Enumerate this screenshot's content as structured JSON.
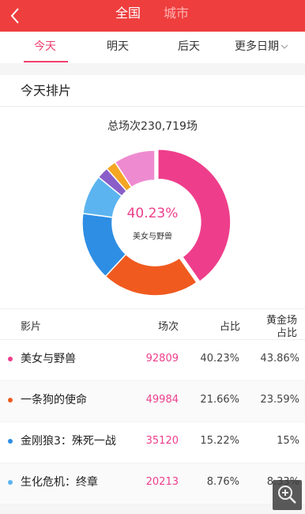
{
  "header": {
    "segments": {
      "nation": "全国",
      "city": "城市"
    }
  },
  "tabs": [
    {
      "label": "今天",
      "active": true
    },
    {
      "label": "明天",
      "active": false
    },
    {
      "label": "后天",
      "active": false
    },
    {
      "label": "更多日期",
      "active": false
    }
  ],
  "section": {
    "title": "今天排片"
  },
  "chart": {
    "total": "总场次230,719场",
    "center_percent": "40.23%",
    "center_name": "美女与野兽"
  },
  "chart_data": {
    "type": "pie",
    "total_sessions": 230719,
    "slices": [
      {
        "name": "美女与野兽",
        "value": 40.23,
        "color": "#ee3e8b"
      },
      {
        "name": "一条狗的使命",
        "value": 21.66,
        "color": "#f05a1f"
      },
      {
        "name": "金刚狼3：殊死一战",
        "value": 15.22,
        "color": "#2e8ee4"
      },
      {
        "name": "生化危机：终章",
        "value": 8.76,
        "color": "#5bb4f0"
      },
      {
        "name": "",
        "value": 2.6,
        "color": "#8a5ec8"
      },
      {
        "name": "",
        "value": 2.3,
        "color": "#f5a623"
      },
      {
        "name": "",
        "value": 9.23,
        "color": "#ee8bd0"
      }
    ]
  },
  "table": {
    "headers": {
      "film": "影片",
      "sessions": "场次",
      "share": "占比",
      "gold_line1": "黄金场",
      "gold_line2": "占比"
    },
    "rows": [
      {
        "name": "美女与野兽",
        "sessions": "92809",
        "share": "40.23%",
        "gold": "43.86%",
        "color": "#ee3e8b"
      },
      {
        "name": "一条狗的使命",
        "sessions": "49984",
        "share": "21.66%",
        "gold": "23.59%",
        "color": "#f05a1f"
      },
      {
        "name": "金刚狼3：殊死一战",
        "sessions": "35120",
        "share": "15.22%",
        "gold": "15%",
        "color": "#2e8ee4"
      },
      {
        "name": "生化危机：终章",
        "sessions": "20213",
        "share": "8.76%",
        "gold": "8.33%",
        "color": "#5bb4f0"
      }
    ]
  },
  "icons": {
    "back": "back-arrow-icon",
    "chevron": "chevron-down-icon",
    "zoom": "zoom-in-icon"
  }
}
